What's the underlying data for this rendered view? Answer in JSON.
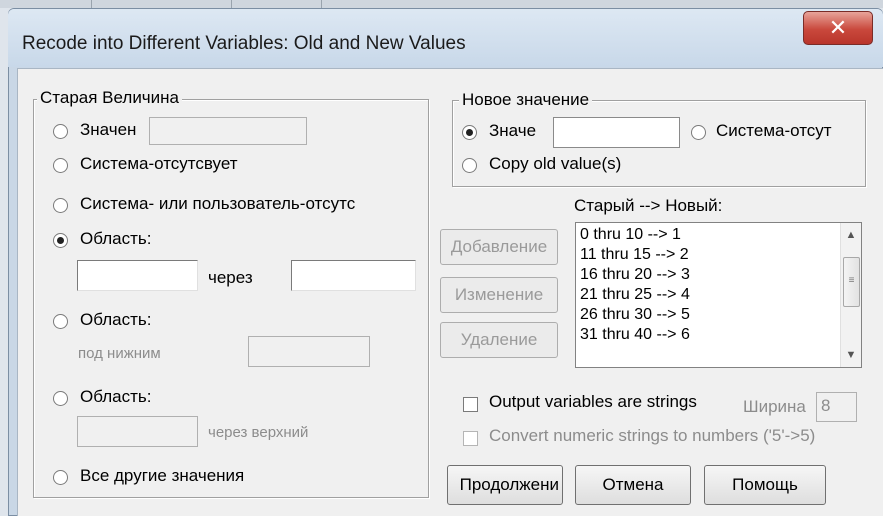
{
  "window": {
    "title": "Recode into Different Variables: Old and New Values",
    "close_glyph": "✕"
  },
  "old_value": {
    "group_label": "Старая Величина",
    "value_label": "Значен",
    "value_text": "",
    "system_missing_label": "Система-отсутсвует",
    "system_or_user_missing_label": "Система- или пользователь-отсутс",
    "range_label": "Область:",
    "range_through_label": "через",
    "range_from": "",
    "range_to": "",
    "range_lowest_label": "Область:",
    "lowest_through_label": "под нижним",
    "range_lowest_value": "",
    "range_highest_label": "Область:",
    "through_highest_label": "через верхний",
    "range_highest_value": "",
    "all_other_label": "Все другие значения",
    "selected": "range"
  },
  "new_value": {
    "group_label": "Новое значение",
    "value_label": "Значе",
    "value_text": "",
    "system_missing_label": "Система-отсут",
    "copy_old_label": "Copy old value(s)",
    "selected": "value"
  },
  "mapping": {
    "header": "Старый --> Новый:",
    "items": [
      "0 thru 10 --> 1",
      "11 thru 15 --> 2",
      "16 thru 20 --> 3",
      "21 thru 25 --> 4",
      "26 thru 30 --> 5",
      "31 thru 40 --> 6"
    ],
    "add_label": "Добавление",
    "change_label": "Изменение",
    "remove_label": "Удаление"
  },
  "options": {
    "output_strings_label": "Output variables are strings",
    "width_label": "Ширина",
    "width_value": "8",
    "convert_label": "Convert numeric strings to numbers ('5'->5)"
  },
  "buttons": {
    "continue_label": "Продолжени",
    "cancel_label": "Отмена",
    "help_label": "Помощь"
  }
}
